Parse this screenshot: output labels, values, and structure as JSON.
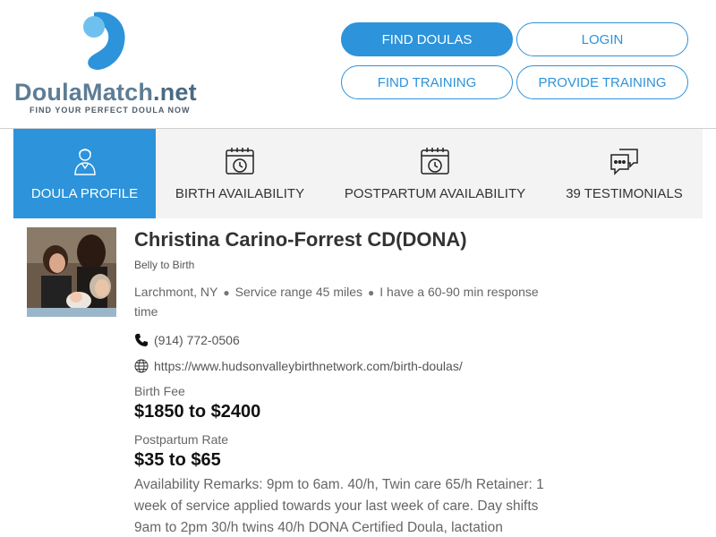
{
  "header": {
    "logo_text": "DoulaMatch",
    "logo_suffix": ".net",
    "tagline": "FIND YOUR PERFECT DOULA NOW",
    "brand_color": "#2d93da",
    "nav": {
      "find_doulas": "FIND DOULAS",
      "login": "LOGIN",
      "find_training": "FIND TRAINING",
      "provide_training": "PROVIDE TRAINING"
    }
  },
  "tabs": [
    {
      "label": "DOULA PROFILE",
      "icon": "person-icon",
      "active": true
    },
    {
      "label": "BIRTH AVAILABILITY",
      "icon": "calendar-clock-icon",
      "active": false
    },
    {
      "label": "POSTPARTUM AVAILABILITY",
      "icon": "calendar-clock-icon",
      "active": false
    },
    {
      "label": "39 TESTIMONIALS",
      "icon": "chat-bubbles-icon",
      "active": false
    }
  ],
  "profile": {
    "name": "Christina Carino-Forrest CD(DONA)",
    "business": "Belly to Birth",
    "location": "Larchmont, NY",
    "service_range": "Service range 45 miles",
    "response": "I have a 60-90 min response time",
    "phone": "(914) 772-0506",
    "website": "https://www.hudsonvalleybirthnetwork.com/birth-doulas/",
    "birth_fee_label": "Birth Fee",
    "birth_fee": "$1850 to $2400",
    "postpartum_label": "Postpartum Rate",
    "postpartum_rate": "$35 to $65",
    "remarks": "Availability Remarks: 9pm to 6am. 40/h, Twin care 65/h Retainer: 1 week of service applied towards your last week of care. Day shifts 9am to 2pm 30/h twins 40/h DONA Certified Doula, lactation"
  }
}
